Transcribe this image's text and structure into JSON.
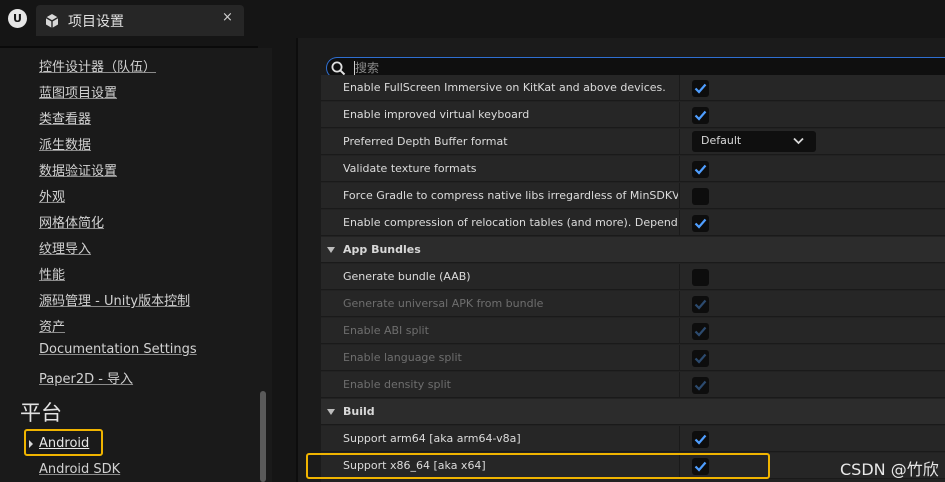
{
  "window": {
    "tab_title": "项目设置",
    "close_glyph": "×"
  },
  "nav": {
    "items": [
      "控件设计器（队伍）",
      "蓝图项目设置",
      "类查看器",
      "派生数据",
      "数据验证设置",
      "外观",
      "网格体简化",
      "纹理导入",
      "性能",
      "源码管理 - Unity版本控制",
      "资产",
      "Documentation Settings",
      "Paper2D - 导入"
    ],
    "section_title": "平台",
    "selected": "Android",
    "next": "Android SDK"
  },
  "search": {
    "placeholder": "搜索",
    "value": ""
  },
  "settings": {
    "rows": [
      {
        "label": "Enable FullScreen Immersive on KitKat and above devices.",
        "type": "check",
        "checked": true,
        "disabled": false
      },
      {
        "label": "Enable improved virtual keyboard",
        "type": "check",
        "checked": true,
        "disabled": false
      },
      {
        "label": "Preferred Depth Buffer format",
        "type": "dropdown",
        "value": "Default"
      },
      {
        "label": "Validate texture formats",
        "type": "check",
        "checked": true,
        "disabled": false
      },
      {
        "label": "Force Gradle to compress native libs irregardless of MinSDKVersion setting",
        "type": "check",
        "checked": false,
        "disabled": false
      },
      {
        "label": "Enable compression of relocation tables (and more). Depends on MinSDKVersion",
        "type": "check",
        "checked": true,
        "disabled": false
      },
      {
        "label": "App Bundles",
        "type": "category"
      },
      {
        "label": "Generate bundle (AAB)",
        "type": "check",
        "checked": false,
        "disabled": false
      },
      {
        "label": "Generate universal APK from bundle",
        "type": "check",
        "checked": true,
        "disabled": true
      },
      {
        "label": "Enable ABI split",
        "type": "check",
        "checked": true,
        "disabled": true
      },
      {
        "label": "Enable language split",
        "type": "check",
        "checked": true,
        "disabled": true
      },
      {
        "label": "Enable density split",
        "type": "check",
        "checked": true,
        "disabled": true
      },
      {
        "label": "Build",
        "type": "category"
      },
      {
        "label": "Support arm64 [aka arm64-v8a]",
        "type": "check",
        "checked": true,
        "disabled": false
      },
      {
        "label": "Support x86_64 [aka x64]",
        "type": "check",
        "checked": true,
        "disabled": false
      }
    ]
  },
  "watermark": "CSDN @竹欣",
  "colors": {
    "accent": "#2f6fd1",
    "highlight": "#f0b400",
    "check": "#4f9eff"
  }
}
